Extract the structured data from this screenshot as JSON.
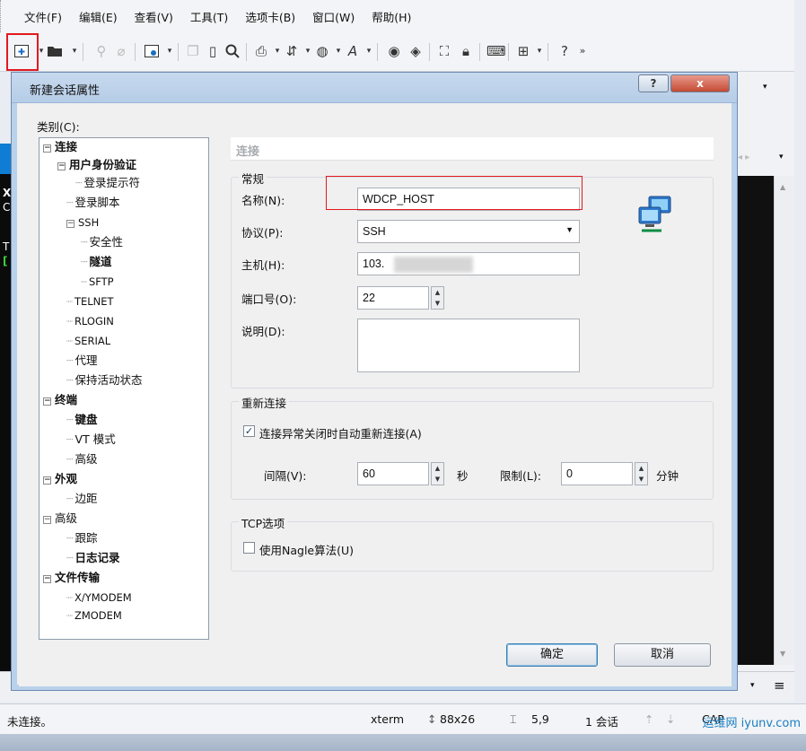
{
  "menubar": {
    "items": [
      "文件(F)",
      "编辑(E)",
      "查看(V)",
      "工具(T)",
      "选项卡(B)",
      "窗口(W)",
      "帮助(H)"
    ]
  },
  "toolbar": {
    "icons": [
      "new-session-icon",
      "open-folder-icon",
      "link-icon",
      "disconnect-icon",
      "properties-icon",
      "copy-icon",
      "paste-icon",
      "find-icon",
      "print-icon",
      "transfer-icon",
      "globe-icon",
      "font-icon",
      "xmanager-icon",
      "xftp-icon",
      "fullscreen-icon",
      "lock-icon",
      "keyboard-icon",
      "compose-icon",
      "help-icon"
    ],
    "more": "»"
  },
  "dialog": {
    "title": "新建会话属性",
    "help_button": "?",
    "close_button": "x",
    "category_label": "类别(C):",
    "tree": [
      {
        "label": "连接",
        "bold": true,
        "expander": "−"
      },
      {
        "label": "用户身份验证",
        "bold": true,
        "expander": "−"
      },
      {
        "label": "登录提示符"
      },
      {
        "label": "登录脚本"
      },
      {
        "label": "SSH",
        "expander": "−"
      },
      {
        "label": "安全性"
      },
      {
        "label": "隧道",
        "bold": true
      },
      {
        "label": "SFTP"
      },
      {
        "label": "TELNET"
      },
      {
        "label": "RLOGIN"
      },
      {
        "label": "SERIAL"
      },
      {
        "label": "代理"
      },
      {
        "label": "保持活动状态"
      },
      {
        "label": "终端",
        "bold": true,
        "expander": "−"
      },
      {
        "label": "键盘",
        "bold": true
      },
      {
        "label": "VT 模式"
      },
      {
        "label": "高级"
      },
      {
        "label": "外观",
        "bold": true,
        "expander": "−"
      },
      {
        "label": "边距"
      },
      {
        "label": "高级",
        "expander": "−"
      },
      {
        "label": "跟踪"
      },
      {
        "label": "日志记录",
        "bold": true
      },
      {
        "label": "文件传输",
        "bold": true,
        "expander": "−"
      },
      {
        "label": "X/YMODEM"
      },
      {
        "label": "ZMODEM"
      }
    ],
    "section_header": "连接",
    "general": {
      "title": "常规",
      "name_label": "名称(N):",
      "name_value": "WDCP_HOST",
      "protocol_label": "协议(P):",
      "protocol_value": "SSH",
      "host_label": "主机(H):",
      "host_value": "103.",
      "port_label": "端口号(O):",
      "port_value": "22",
      "desc_label": "说明(D):",
      "desc_value": ""
    },
    "reconnect": {
      "title": "重新连接",
      "auto_label": "连接异常关闭时自动重新连接(A)",
      "auto_checked": true,
      "interval_label": "间隔(V):",
      "interval_value": "60",
      "interval_unit": "秒",
      "limit_label": "限制(L):",
      "limit_value": "0",
      "limit_unit": "分钟"
    },
    "tcp": {
      "title": "TCP选项",
      "nagle_label": "使用Nagle算法(U)",
      "nagle_checked": false
    },
    "ok_button": "确定",
    "cancel_button": "取消"
  },
  "terminal": {
    "lines": [
      "X",
      "C",
      "T",
      "["
    ]
  },
  "statusbar": {
    "connection": "未连接。",
    "term_type": "xterm",
    "size": "88x26",
    "cursor": "5,9",
    "sessions": "1 会话",
    "caps": "CAP"
  },
  "watermark": "运维网 iyunv.com"
}
